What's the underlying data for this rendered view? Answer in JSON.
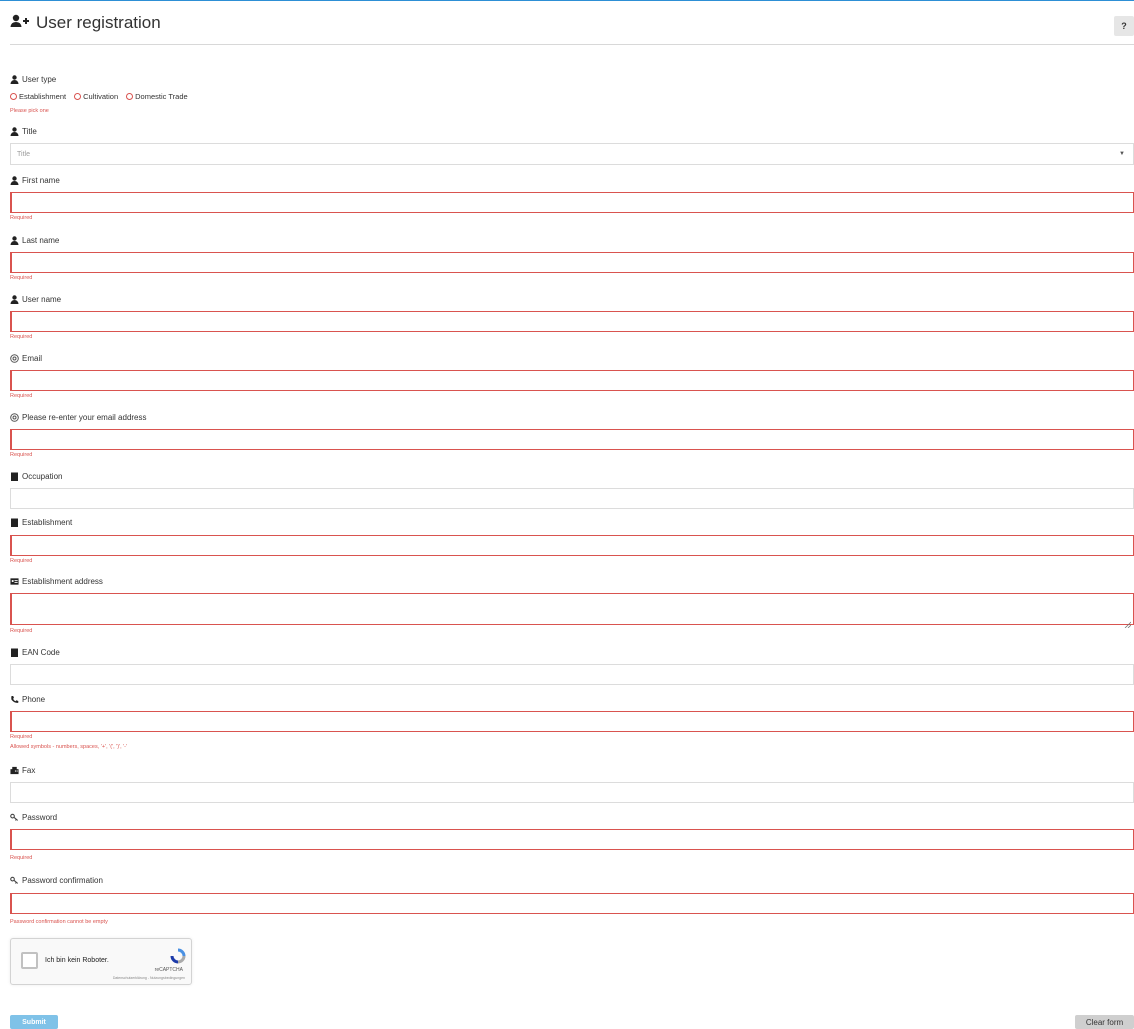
{
  "header": {
    "title": "User registration",
    "help_label": "?"
  },
  "user_type": {
    "label": "User type",
    "options": [
      "Establishment",
      "Cultivation",
      "Domestic Trade"
    ],
    "error": "Please pick one"
  },
  "title_field": {
    "label": "Title",
    "placeholder": "Title"
  },
  "first_name": {
    "label": "First name",
    "error": "Required"
  },
  "last_name": {
    "label": "Last name",
    "error": "Required"
  },
  "user_name": {
    "label": "User name",
    "error": "Required"
  },
  "email": {
    "label": "Email",
    "error": "Required"
  },
  "email_confirm": {
    "label": "Please re-enter your email address",
    "error": "Required"
  },
  "occupation": {
    "label": "Occupation"
  },
  "establishment": {
    "label": "Establishment",
    "error": "Required"
  },
  "establishment_address": {
    "label": "Establishment address",
    "error": "Required"
  },
  "ean_code": {
    "label": "EAN Code"
  },
  "phone": {
    "label": "Phone",
    "error": "Required",
    "hint": "Allowed symbols - numbers, spaces, '+', '(', ')', '-'"
  },
  "fax": {
    "label": "Fax"
  },
  "password": {
    "label": "Password",
    "error": "Required"
  },
  "password_confirm": {
    "label": "Password confirmation",
    "error": "Password confirmation cannot be empty"
  },
  "recaptcha": {
    "label": "Ich bin kein Roboter.",
    "brand": "reCAPTCHA",
    "links": "Datenschutzerklärung - Nutzungsbedingungen"
  },
  "actions": {
    "submit": "Submit",
    "clear": "Clear form"
  },
  "colors": {
    "accent": "#2d8fd5",
    "error": "#d9534f",
    "submit": "#7fc2e8"
  }
}
